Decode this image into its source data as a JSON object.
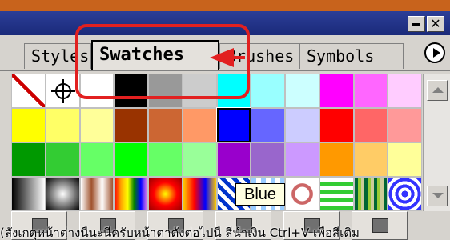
{
  "window": {
    "minimize_label": "_",
    "close_label": "✕"
  },
  "tabs": [
    {
      "label": "Styles",
      "active": false
    },
    {
      "label": "Swatches",
      "active": true
    },
    {
      "label": "Brushes",
      "active": false
    },
    {
      "label": "Symbols",
      "active": false
    }
  ],
  "tab_menu_icon": "circle-arrow-right-icon",
  "swatches": {
    "rows": [
      [
        "none",
        "registration",
        "#ffffff",
        "#000000",
        "#999999",
        "#cccccc",
        "#00ffff",
        "#99ffff",
        "#ccffff",
        "#ff00ff",
        "#ff66ff",
        "#ffccff"
      ],
      [
        "#ffff00",
        "#ffff66",
        "#ffff99",
        "#993300",
        "#cc6633",
        "#ff9966",
        "#0000ff",
        "#6666ff",
        "#ccccff",
        "#ff0000",
        "#ff6666",
        "#ff9999"
      ],
      [
        "#009900",
        "#33cc33",
        "#66ff66",
        "#00ff00",
        "#66ff66",
        "#99ff99",
        "#9900cc",
        "#9966cc",
        "#cc99ff",
        "#ff9900",
        "#ffcc66",
        "#ffff99"
      ],
      [
        "gradient",
        "gradient",
        "pattern",
        "gradient",
        "gradient",
        "gradient",
        "pattern",
        "pattern",
        "pattern",
        "pattern",
        "pattern",
        "pattern"
      ]
    ],
    "selected_color": "#0000ff"
  },
  "tooltip": {
    "text": "Blue"
  },
  "bottom_buttons": [
    "show-swatch-kinds-icon",
    "show-color-swatches-icon",
    "show-gradient-swatches-icon",
    "show-pattern-swatches-icon",
    "new-swatch-icon",
    "delete-swatch-icon"
  ],
  "highlight_color": "#e22020",
  "caption": "(สังเกตุหน้าต่างนี้นะนี่ครับหน้าตาตั้งต่อไปนี้  สีน้ำเงิน Ctrl+V เพื่อสีเติม"
}
